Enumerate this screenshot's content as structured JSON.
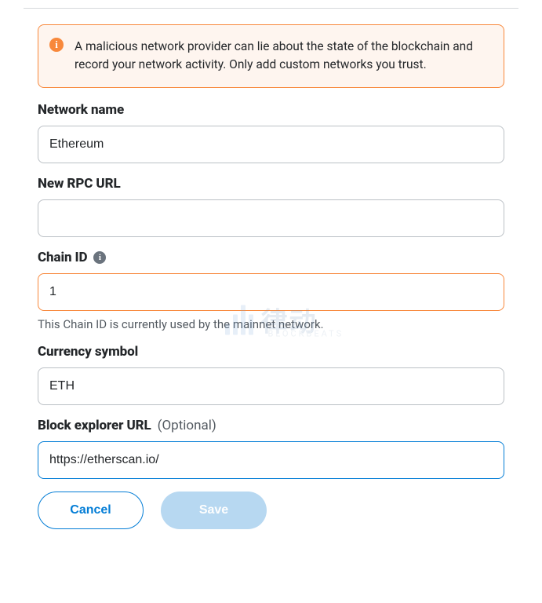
{
  "alert": {
    "text": "A malicious network provider can lie about the state of the blockchain and record your network activity. Only add custom networks you trust.",
    "icon_name": "info-icon"
  },
  "fields": {
    "network_name": {
      "label": "Network name",
      "value": "Ethereum"
    },
    "rpc_url": {
      "label": "New RPC URL",
      "value": ""
    },
    "chain_id": {
      "label": "Chain ID",
      "value": "1",
      "error": "This Chain ID is currently used by the mainnet network."
    },
    "currency": {
      "label": "Currency symbol",
      "value": "ETH"
    },
    "explorer": {
      "label": "Block explorer URL",
      "optional": "(Optional)",
      "value": "https://etherscan.io/"
    }
  },
  "buttons": {
    "cancel": "Cancel",
    "save": "Save"
  },
  "watermark": {
    "cn": "律动",
    "en": "BLOCKBEATS"
  }
}
